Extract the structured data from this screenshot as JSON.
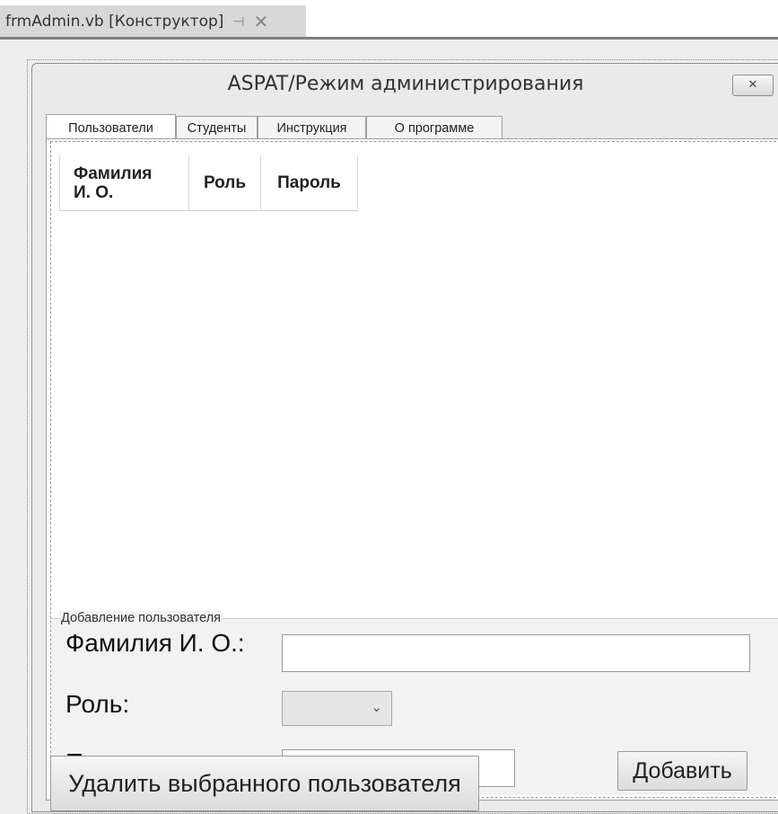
{
  "document_tab": {
    "title": "frmAdmin.vb [Конструктор]",
    "pin_icon": "⊣",
    "close_icon": "✕"
  },
  "form": {
    "title": "ASPAT/Режим администрирования",
    "close_icon": "✕"
  },
  "tabs": [
    {
      "label": "Пользователи",
      "active": true
    },
    {
      "label": "Студенты",
      "active": false
    },
    {
      "label": "Инструкция",
      "active": false
    },
    {
      "label": "О программе",
      "active": false
    }
  ],
  "grid": {
    "columns": [
      "Фамилия\nИ. О.",
      "Роль",
      "Пароль"
    ]
  },
  "add_user": {
    "legend": "Добавление пользователя",
    "fio_label": "Фамилия И. О.:",
    "fio_value": "",
    "role_label": "Роль:",
    "role_value": "",
    "role_arrow_icon": "⌄",
    "password_label": "Пароль:",
    "password_value": "",
    "add_button": "Добавить"
  },
  "delete_button": "Удалить выбранного пользователя"
}
